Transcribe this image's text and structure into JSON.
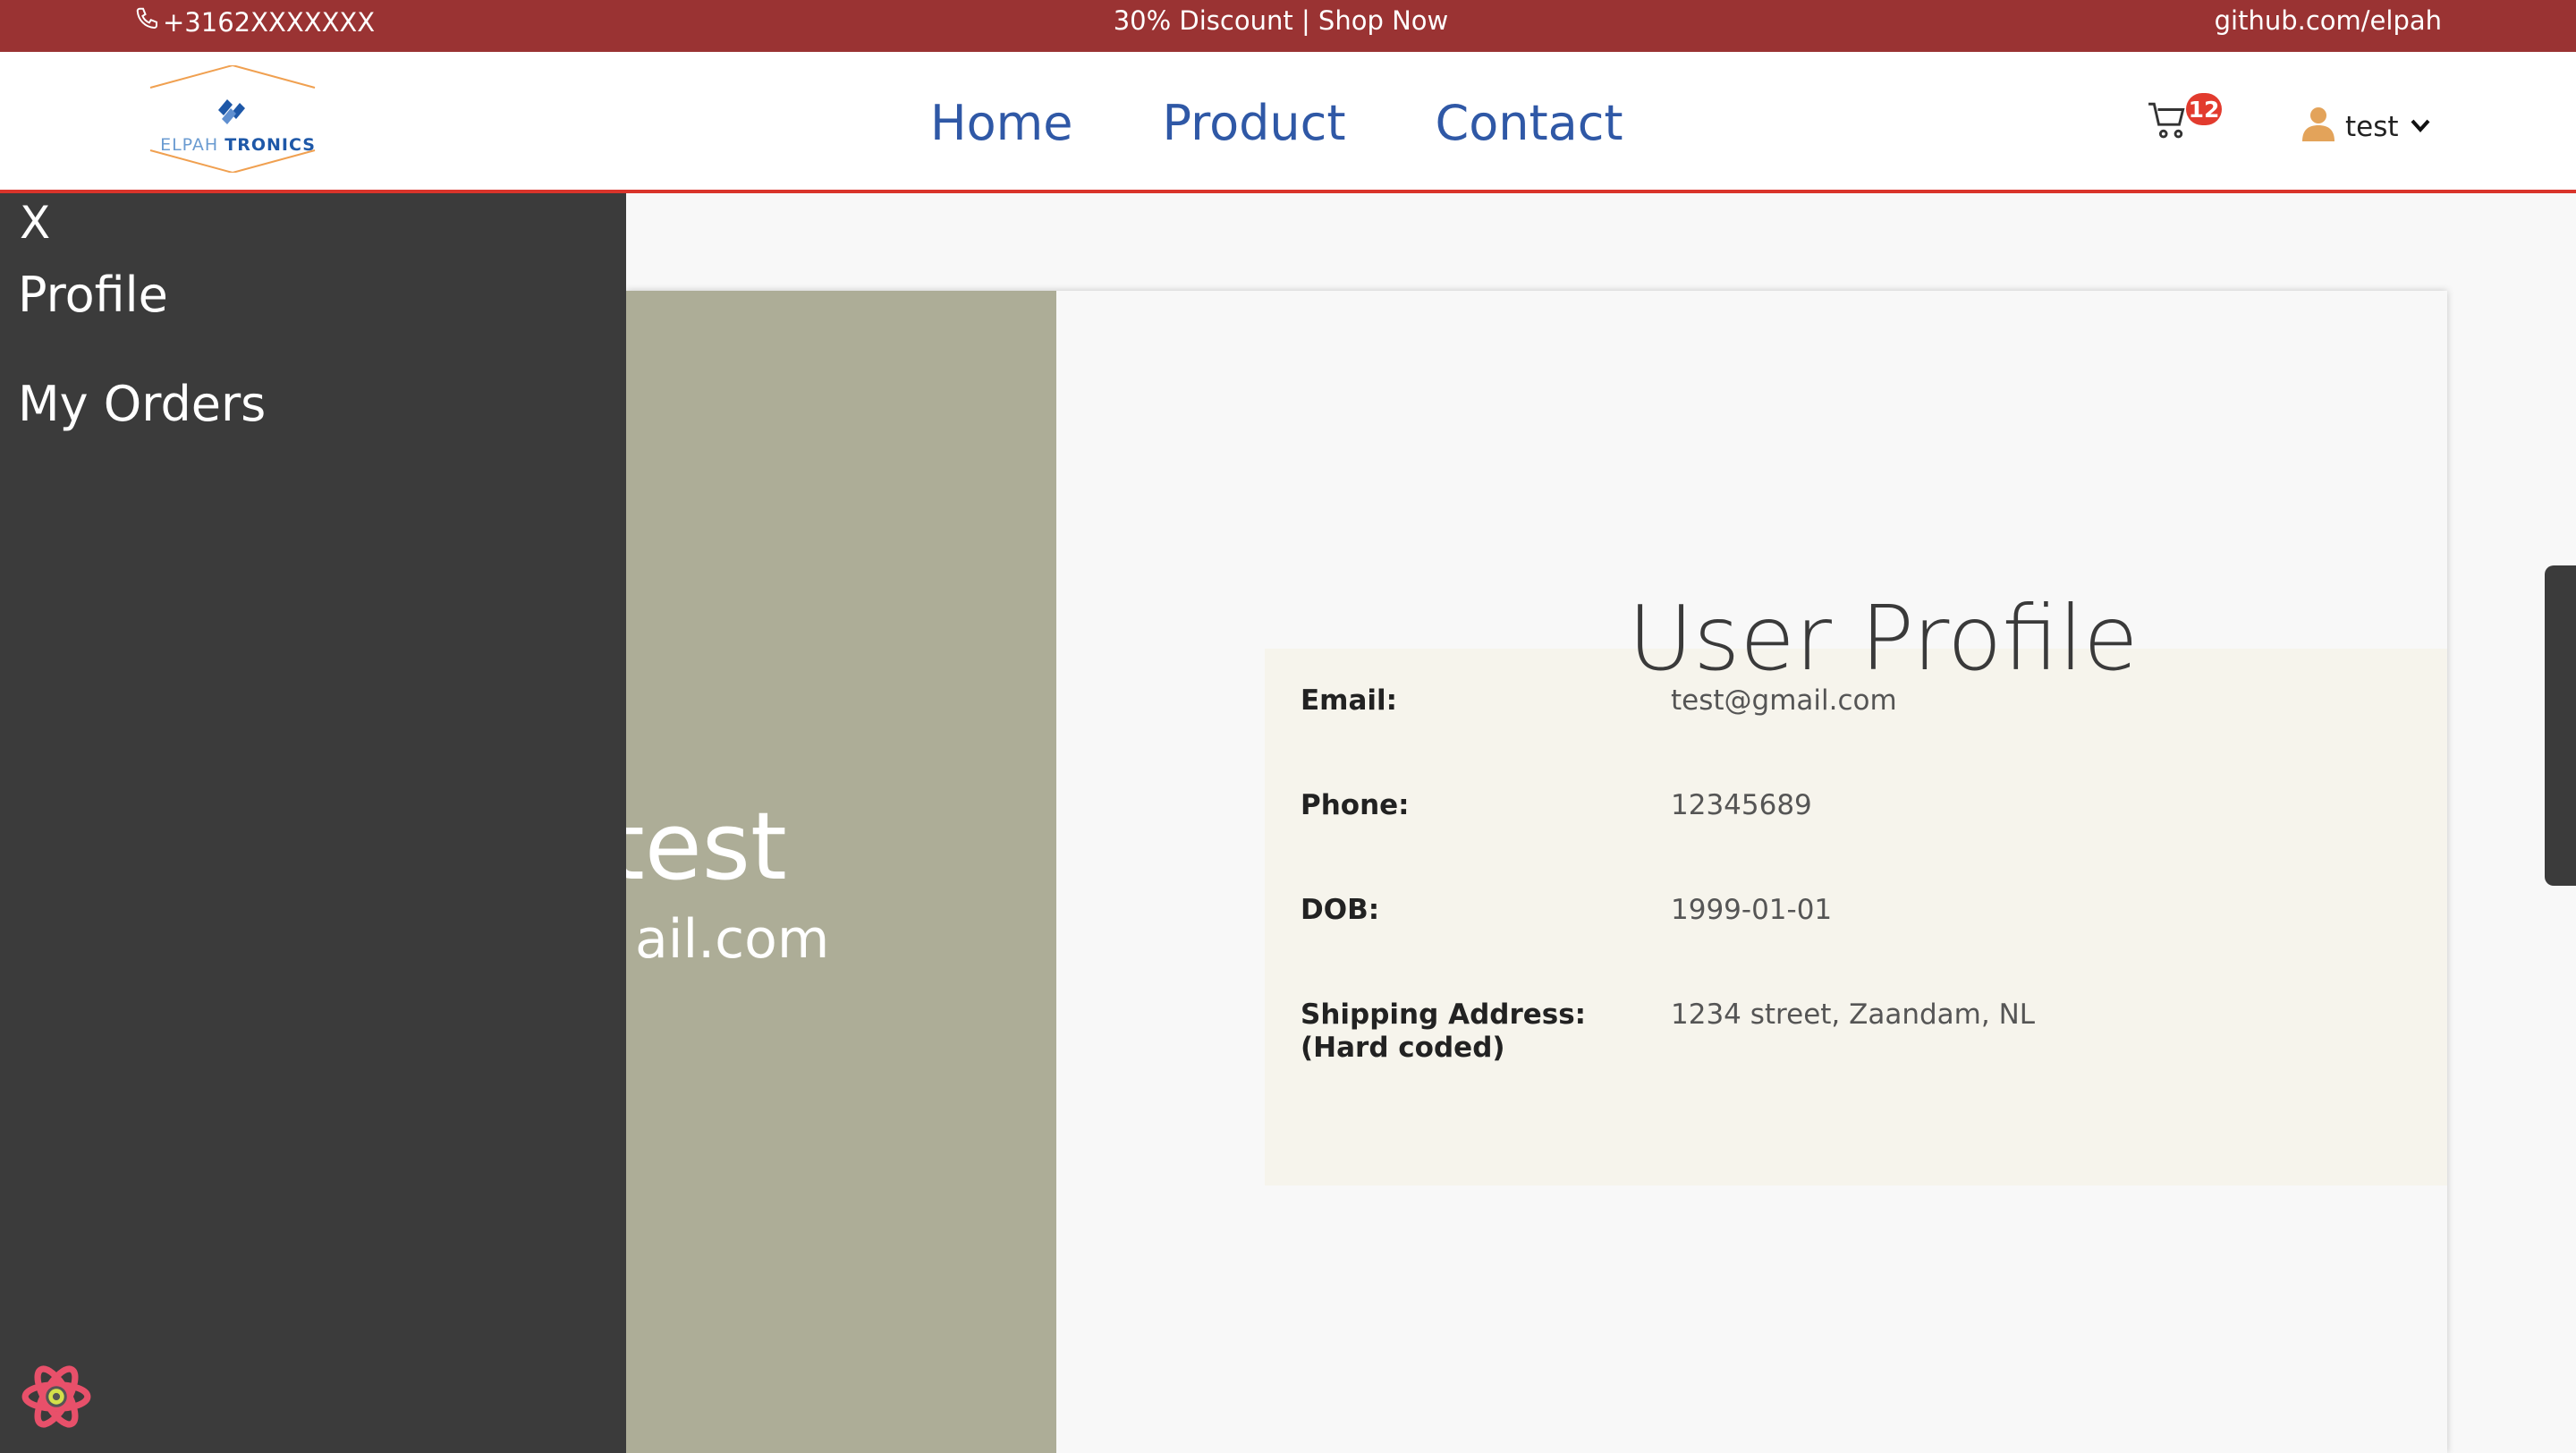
{
  "topbar": {
    "phone": "+3162XXXXXXX",
    "promo": "30% Discount | Shop Now",
    "github": "github.com/elpah"
  },
  "brand": {
    "logo_part1": "ELPAH",
    "logo_part2": "TRONICS"
  },
  "nav": {
    "home": "Home",
    "product": "Product",
    "contact": "Contact"
  },
  "cart": {
    "count": "12"
  },
  "user_menu": {
    "username": "test"
  },
  "sidebar": {
    "close_label": "X",
    "items": [
      "Profile",
      "My Orders"
    ]
  },
  "profile_card": {
    "name": "test",
    "email": "ail.com"
  },
  "profile": {
    "title": "User Profile",
    "rows": [
      {
        "label": "Email:",
        "value": "test@gmail.com"
      },
      {
        "label": "Phone:",
        "value": "12345689"
      },
      {
        "label": "DOB:",
        "value": "1999-01-01"
      },
      {
        "label": "Shipping Address: (Hard coded)",
        "value": "1234 street, Zaandam, NL"
      }
    ]
  },
  "icons": {
    "phone": "phone-icon",
    "cart": "cart-icon",
    "user": "user-icon",
    "chevron": "chevron-down-icon",
    "react": "react-icon"
  },
  "colors": {
    "topbar": "#9a3333",
    "nav_link": "#2f58a6",
    "badge": "#e23b2e",
    "sidebar": "#3b3b3b",
    "card_left": "#adad97",
    "info_box": "#f6f4ec",
    "nav_border": "#d9342b",
    "user_icon": "#e3a35a"
  }
}
